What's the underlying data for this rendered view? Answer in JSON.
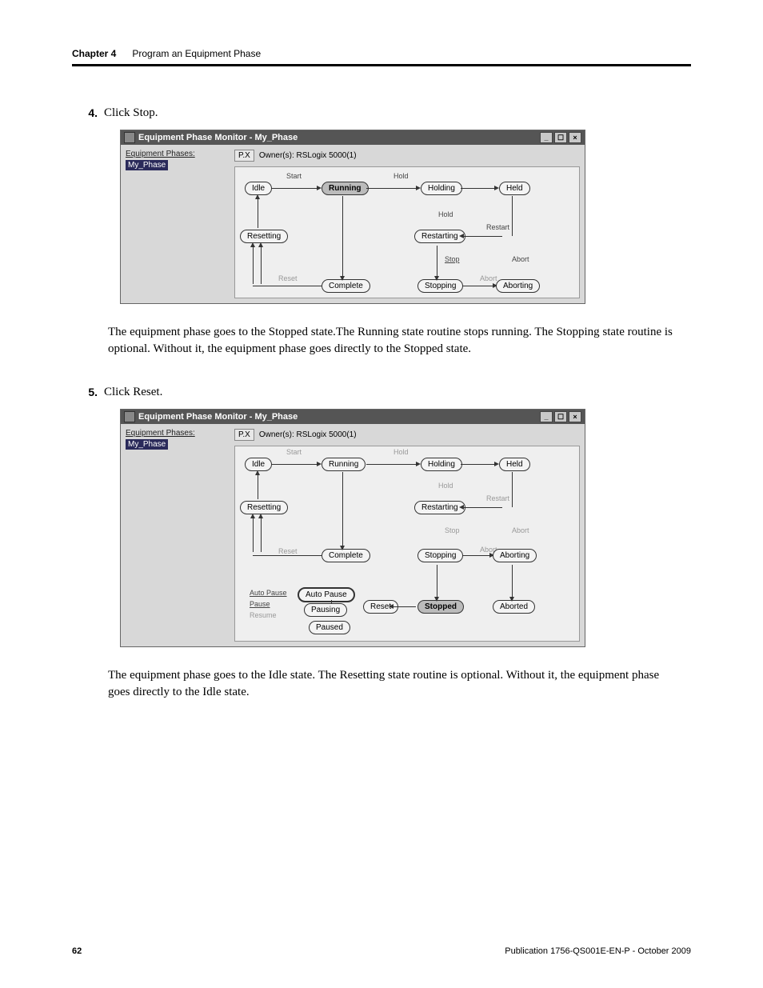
{
  "header": {
    "chapter": "Chapter 4",
    "title": "Program an Equipment Phase"
  },
  "step4": {
    "num": "4.",
    "text": "Click Stop."
  },
  "step5": {
    "num": "5.",
    "text": "Click Reset."
  },
  "win": {
    "title": "Equipment Phase Monitor - My_Phase",
    "min": "_",
    "max": "☐",
    "close": "×",
    "leftLabel": "Equipment Phases:",
    "treeItem": "My_Phase",
    "ownerIcon": "P.X",
    "owner": "Owner(s): RSLogix 5000(1)"
  },
  "states": {
    "idle": "Idle",
    "running": "Running",
    "holding": "Holding",
    "held": "Held",
    "resetting": "Resetting",
    "restarting": "Restarting",
    "complete": "Complete",
    "stopping": "Stopping",
    "aborting": "Aborting",
    "pausing": "Pausing",
    "paused": "Paused",
    "stopped": "Stopped",
    "aborted": "Aborted"
  },
  "labels": {
    "start": "Start",
    "hold": "Hold",
    "holdcmd": "Hold",
    "restart": "Restart",
    "stop": "Stop",
    "abort": "Abort",
    "reset": "Reset",
    "abortcmd": "Abort",
    "autopause1": "Auto Pause",
    "autopause2": "Auto Pause",
    "pause": "Pause",
    "resume": "Resume",
    "resetbtn": "Reset"
  },
  "para1": "The equipment phase goes to the Stopped state.The Running state routine stops running. The Stopping state routine is optional. Without it, the equipment phase goes directly to the Stopped state.",
  "para2": "The equipment phase goes to the Idle state. The Resetting state routine is optional. Without it, the equipment phase goes directly to the Idle state.",
  "footer": {
    "page": "62",
    "pub": "Publication 1756-QS001E-EN-P - October 2009"
  }
}
